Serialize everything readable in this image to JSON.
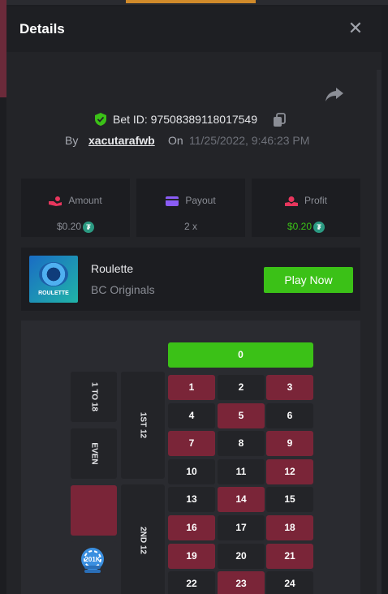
{
  "modal": {
    "title": "Details",
    "close_label": "✕"
  },
  "bet": {
    "id_label": "Bet ID: 97508389118017549",
    "by_label": "By",
    "username": "xacutarafwb",
    "on_label": "On",
    "date": "11/25/2022, 9:46:23 PM"
  },
  "stats": [
    {
      "title": "Amount",
      "value": "$0.20",
      "value_color": "#8b8e96",
      "icon": "hand-coin-icon",
      "icon_color": "#e8365d"
    },
    {
      "title": "Payout",
      "value": "2 x",
      "value_color": "#8b8e96",
      "icon": "wallet-icon",
      "icon_color": "#8a5cf5"
    },
    {
      "title": "Profit",
      "value": "$0.20",
      "value_color": "#3bc117",
      "icon": "hand-profit-icon",
      "icon_color": "#e8365d"
    }
  ],
  "currency_symbol": "₮",
  "game": {
    "thumb_label": "ROULETTE",
    "name": "Roulette",
    "provider": "BC Originals",
    "play_label": "Play Now"
  },
  "roulette": {
    "zero": "0",
    "rows": [
      [
        {
          "n": "1",
          "c": "red"
        },
        {
          "n": "2",
          "c": "black"
        },
        {
          "n": "3",
          "c": "red"
        }
      ],
      [
        {
          "n": "4",
          "c": "black"
        },
        {
          "n": "5",
          "c": "red"
        },
        {
          "n": "6",
          "c": "black"
        }
      ],
      [
        {
          "n": "7",
          "c": "red"
        },
        {
          "n": "8",
          "c": "black"
        },
        {
          "n": "9",
          "c": "red"
        }
      ],
      [
        {
          "n": "10",
          "c": "black"
        },
        {
          "n": "11",
          "c": "black"
        },
        {
          "n": "12",
          "c": "red"
        }
      ],
      [
        {
          "n": "13",
          "c": "black"
        },
        {
          "n": "14",
          "c": "red"
        },
        {
          "n": "15",
          "c": "black"
        }
      ],
      [
        {
          "n": "16",
          "c": "red"
        },
        {
          "n": "17",
          "c": "black"
        },
        {
          "n": "18",
          "c": "red"
        }
      ],
      [
        {
          "n": "19",
          "c": "red"
        },
        {
          "n": "20",
          "c": "black"
        },
        {
          "n": "21",
          "c": "red"
        }
      ],
      [
        {
          "n": "22",
          "c": "black"
        },
        {
          "n": "23",
          "c": "red"
        },
        {
          "n": "24",
          "c": "black"
        }
      ]
    ],
    "outside_bets": {
      "low": "1 TO 18",
      "even": "EVEN",
      "first_dozen": "1ST 12",
      "second_dozen": "2ND 12"
    },
    "chip_label": "201K"
  },
  "colors": {
    "red": "#7a2538",
    "black": "#232428",
    "green": "#3bc117",
    "accent_profit": "#3bc117"
  }
}
